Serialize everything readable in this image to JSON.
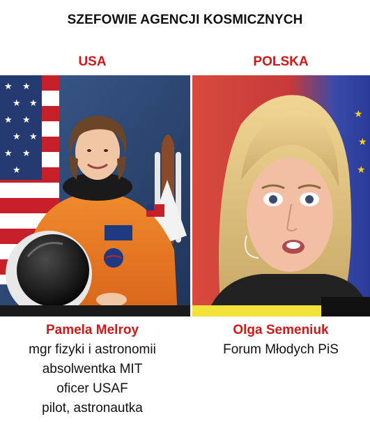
{
  "title": "SZEFOWIE AGENCJI KOSMICZNYCH",
  "colors": {
    "accent_red": "#d01818",
    "text": "#111111",
    "left_background": "#2d4a78",
    "right_background": "#c64040",
    "suit_orange": "#e8741c"
  },
  "left": {
    "country": "USA",
    "name": "Pamela Melroy",
    "lines": [
      "mgr fizyki i astronomii",
      "absolwentka MIT",
      "oficer USAF",
      "pilot, astronautka"
    ]
  },
  "right": {
    "country": "POLSKA",
    "name": "Olga Semeniuk",
    "lines": [
      "Forum Młodych PiS"
    ]
  }
}
